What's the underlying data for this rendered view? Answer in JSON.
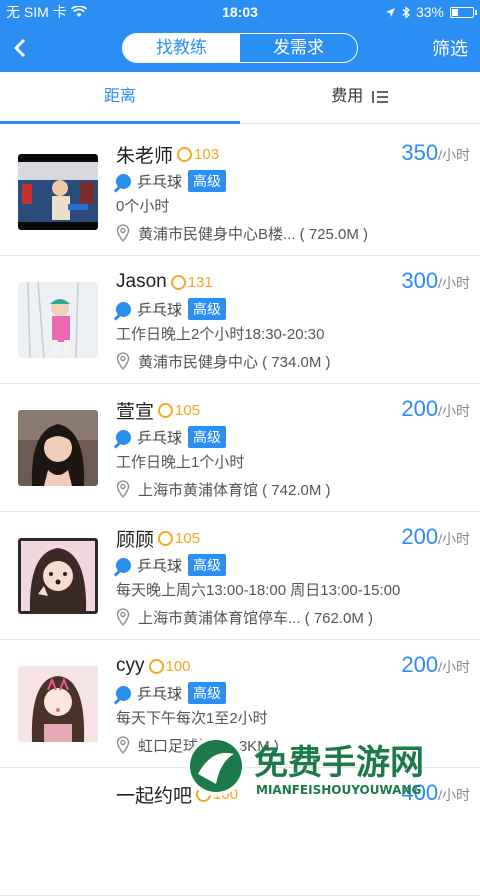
{
  "status": {
    "carrier": "无 SIM 卡",
    "time": "18:03",
    "battery": "33%",
    "battery_level": 0.33
  },
  "nav": {
    "seg_left": "找教练",
    "seg_right": "发需求",
    "filter": "筛选"
  },
  "tabs": {
    "distance": "距离",
    "fee": "费用"
  },
  "coaches": [
    {
      "name": "朱老师",
      "points": "103",
      "price": "350",
      "unit": "/小时",
      "sport": "乒乓球",
      "level": "高级",
      "time": "0个小时",
      "location": "黄浦市民健身中心B楼... ( 725.0M )"
    },
    {
      "name": "Jason",
      "points": "131",
      "price": "300",
      "unit": "/小时",
      "sport": "乒乓球",
      "level": "高级",
      "time": "工作日晚上2个小时18:30-20:30",
      "location": "黄浦市民健身中心 ( 734.0M )"
    },
    {
      "name": "萱宣",
      "points": "105",
      "price": "200",
      "unit": "/小时",
      "sport": "乒乓球",
      "level": "高级",
      "time": "工作日晚上1个小时",
      "location": "上海市黄浦体育馆 ( 742.0M )"
    },
    {
      "name": "顾顾",
      "points": "105",
      "price": "200",
      "unit": "/小时",
      "sport": "乒乓球",
      "level": "高级",
      "time": "每天晚上周六13:00-18:00 周日13:00-15:00",
      "location": "上海市黄浦体育馆停车... ( 762.0M )"
    },
    {
      "name": "cyy",
      "points": "100",
      "price": "200",
      "unit": "/小时",
      "sport": "乒乓球",
      "level": "高级",
      "time": "每天下午每次1至2小时",
      "location": "虹口足球场 ( 4.3KM )"
    },
    {
      "name": "一起约吧",
      "points": "100",
      "price": "400",
      "unit": "/小时",
      "sport": "",
      "level": "",
      "time": "",
      "location": ""
    }
  ],
  "watermark": {
    "title": "免费手游网",
    "subtitle": "MIANFEISHOUYOUWANG"
  }
}
